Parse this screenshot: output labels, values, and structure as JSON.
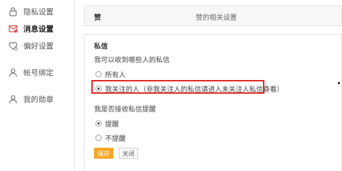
{
  "sidebar": {
    "items": [
      {
        "label": "隐私设置",
        "icon": "lock-icon"
      },
      {
        "label": "消息设置",
        "icon": "message-icon"
      },
      {
        "label": "偏好设置",
        "icon": "heart-settings-icon"
      },
      {
        "label": "帐号绑定",
        "icon": "user-icon"
      },
      {
        "label": "我的勋章",
        "icon": "medal-icon"
      }
    ],
    "active_index": 1
  },
  "likes": {
    "title": "赞",
    "description": "赞的相关设置"
  },
  "private_message": {
    "title": "私信",
    "question1": "我可以收到哪些人的私信",
    "options1": [
      "所有人",
      "我关注的人（非我关注人的私信请进入未关注人私信查看）"
    ],
    "selected1": 1,
    "question2": "我是否接收私信提醒",
    "options2": [
      "提醒",
      "不提醒"
    ],
    "selected2": 0
  },
  "buttons": {
    "save": "保存",
    "close": "关闭"
  },
  "colors": {
    "accent_orange": "#f5a623",
    "highlight_red": "#e02020",
    "icon_red": "#d9534f"
  }
}
